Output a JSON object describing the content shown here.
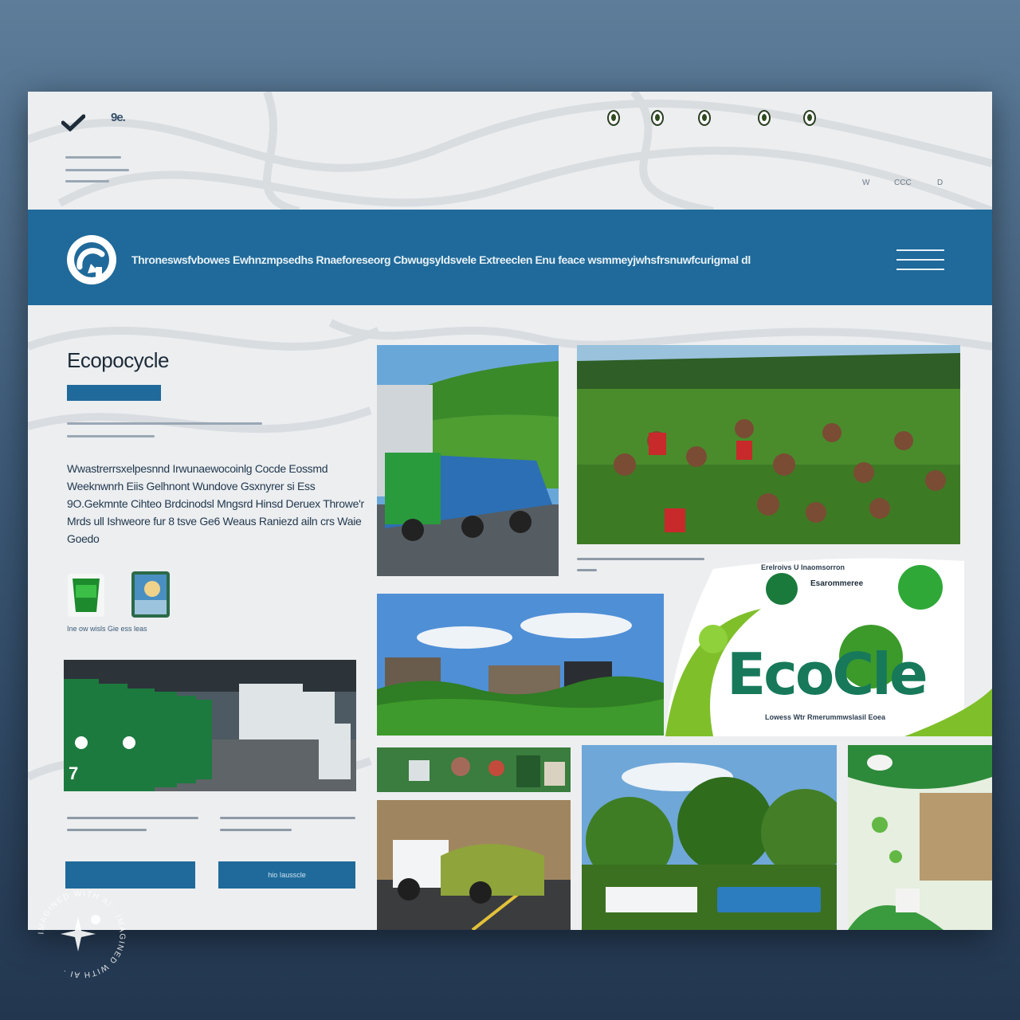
{
  "window": {
    "background": "#2f4a67"
  },
  "topbar": {
    "brand_short": "9e.",
    "nav_links": [
      "W",
      "CCC",
      "D"
    ]
  },
  "band": {
    "tagline": "Throneswsfvbowes Ewhnzmpsedhs Rnaeforeseorg Cbwugsyldsvele Extreeclen Enu feace wsmmeyjwhsfrsnuwfcurigmal dl",
    "accent": "#1f6a9a"
  },
  "main": {
    "site_title": "Ecopocycle",
    "hero_button": "",
    "intro": "Wwastrerrsxelpesnnd Irwunaewocoinlg Cocde Eossmd Weeknwnrh Eiis Gelhnont Wundove Gsxnyrer si Ess 9O.Gekmnte Cihteo Brdcinodsl Mngsrd Hinsd Deruex Throwe'r Mrds ull Ishweore fur 8 tsve Ge6 Weaus Raniezd ailn crs Waie Goedo",
    "mini_caption": "Ine ow wisls Gie ess leas",
    "cta_left": "",
    "cta_right": "hio  Iausscle"
  },
  "badge": {
    "heading": "Erelroivs  U  Inaomsorron",
    "heading2": "Esarommeree",
    "word": "EcoCle",
    "subtitle": "Lowess Wtr Rmerummwslasil Eoea"
  },
  "watermark": {
    "text": "IMAGINED WITH AI · IMAGINED WITH AI ·"
  }
}
